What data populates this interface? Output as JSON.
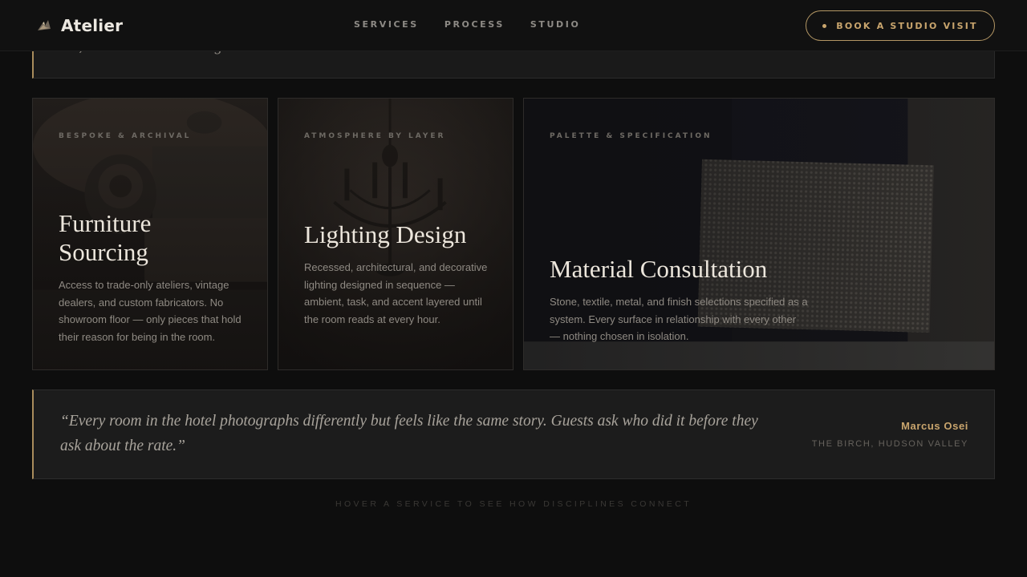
{
  "brand": {
    "name": "Atelier",
    "icon": "dove-logo-icon"
  },
  "nav": {
    "items": [
      "SERVICES",
      "PROCESS",
      "STUDIO"
    ]
  },
  "cta": {
    "label": "BOOK A STUDIO VISIT"
  },
  "partial": {
    "text": "… , … … … … … … … g …"
  },
  "cards": [
    {
      "eyebrow": "BESPOKE & ARCHIVAL",
      "title": "Furniture Sourcing",
      "desc": "Access to trade-only ateliers, vintage dealers, and custom fabricators. No showroom floor — only pieces that hold their reason for being in the room."
    },
    {
      "eyebrow": "ATMOSPHERE BY LAYER",
      "title": "Lighting Design",
      "desc": "Recessed, architectural, and decorative lighting designed in sequence — ambient, task, and accent layered until the room reads at every hour."
    },
    {
      "eyebrow": "PALETTE & SPECIFICATION",
      "title": "Material Consultation",
      "desc": "Stone, textile, metal, and finish selections specified as a system. Every surface in relationship with every other — nothing chosen in isolation."
    }
  ],
  "testimonial": {
    "quote": "“Every room in the hotel photographs differently but feels like the same story. Guests ask who did it before they ask about the rate.”",
    "author": "Marcus Osei",
    "place": "THE BIRCH, HUDSON VALLEY"
  },
  "hint": "HOVER A SERVICE TO SEE HOW DISCIPLINES CONNECT",
  "colors": {
    "accent": "#c9a56d",
    "background": "#0e0e0e",
    "card": "#1b1917"
  }
}
